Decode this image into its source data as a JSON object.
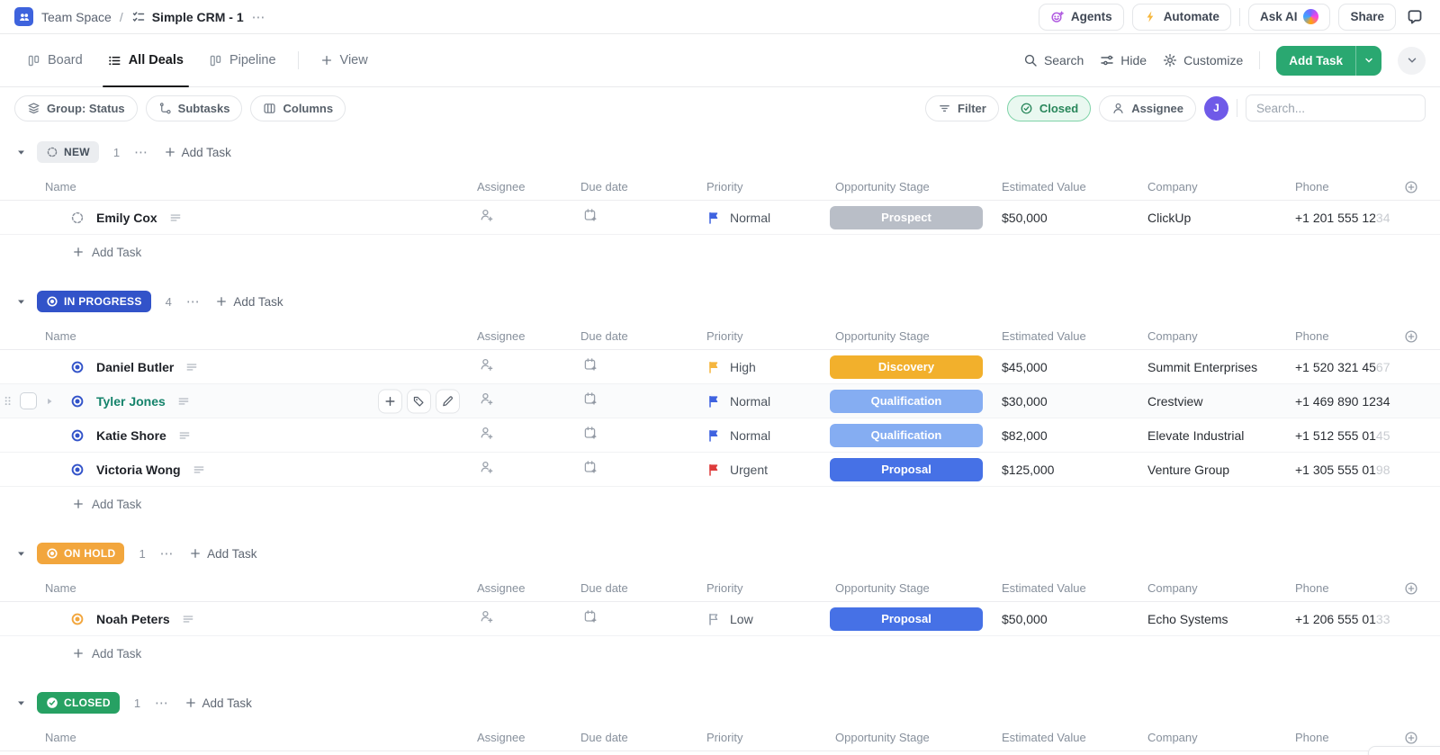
{
  "topbar": {
    "breadcrumb": {
      "space": "Team Space",
      "separator": "/",
      "view": "Simple CRM - 1",
      "more": "⋯"
    },
    "actions": {
      "agents": "Agents",
      "automate": "Automate",
      "ask_ai": "Ask AI",
      "share": "Share"
    }
  },
  "viewbar": {
    "tabs": [
      {
        "label": "Board",
        "icon": "board-icon",
        "active": false
      },
      {
        "label": "All Deals",
        "icon": "list-icon",
        "active": true
      },
      {
        "label": "Pipeline",
        "icon": "board-icon",
        "active": false
      }
    ],
    "add_view": "View",
    "search": "Search",
    "hide": "Hide",
    "customize": "Customize",
    "add_task": "Add Task"
  },
  "toolbar": {
    "group_by": "Group: Status",
    "subtasks": "Subtasks",
    "columns": "Columns",
    "filter": "Filter",
    "closed": "Closed",
    "assignee": "Assignee",
    "avatar_initial": "J",
    "search_placeholder": "Search..."
  },
  "table": {
    "columns": [
      "Name",
      "Assignee",
      "Due date",
      "Priority",
      "Opportunity Stage",
      "Estimated Value",
      "Company",
      "Phone"
    ],
    "add_task_label": "Add Task",
    "more_label": "⋯",
    "colors": {
      "new_pill_bg": "#ebedf0",
      "new_pill_text": "#454f5b",
      "in_progress": "#3253c9",
      "on_hold": "#f2a63d",
      "closed": "#27a163",
      "flag_normal": "#3f63e0",
      "flag_high": "#f5b63f",
      "flag_urgent": "#dd3b3b",
      "flag_low": "#98a1ad",
      "stage_prospect": "#b9bec7",
      "stage_discovery": "#f2b02c",
      "stage_qualification": "#85adf2",
      "stage_proposal": "#4671e6",
      "hover_name": "#15836b"
    },
    "groups": [
      {
        "id": "new",
        "label": "NEW",
        "count": "1",
        "pill_style": "gray",
        "status_icon": "dashed-circle",
        "show_footer": true,
        "rows": [
          {
            "name": "Emily Cox",
            "priority": "Normal",
            "priority_color": "#3f63e0",
            "priority_outline": false,
            "stage": "Prospect",
            "stage_color": "#b9bec7",
            "value": "$50,000",
            "company": "ClickUp",
            "phone": "+1 201 555 1234",
            "phone_fade_chars": 2,
            "hover": false
          }
        ]
      },
      {
        "id": "in-progress",
        "label": "IN PROGRESS",
        "count": "4",
        "pill_style": "blue",
        "status_icon": "ring-dot",
        "show_footer": true,
        "rows": [
          {
            "name": "Daniel Butler",
            "priority": "High",
            "priority_color": "#f5b63f",
            "priority_outline": false,
            "stage": "Discovery",
            "stage_color": "#f2b02c",
            "value": "$45,000",
            "company": "Summit Enterprises",
            "phone": "+1 520 321 4567",
            "phone_fade_chars": 2,
            "hover": false
          },
          {
            "name": "Tyler Jones",
            "priority": "Normal",
            "priority_color": "#3f63e0",
            "priority_outline": false,
            "stage": "Qualification",
            "stage_color": "#85adf2",
            "value": "$30,000",
            "company": "Crestview",
            "phone": "+1 469 890 1234",
            "phone_fade_chars": 0,
            "hover": true
          },
          {
            "name": "Katie Shore",
            "priority": "Normal",
            "priority_color": "#3f63e0",
            "priority_outline": false,
            "stage": "Qualification",
            "stage_color": "#85adf2",
            "value": "$82,000",
            "company": "Elevate Industrial",
            "phone": "+1 512 555 0145",
            "phone_fade_chars": 2,
            "hover": false
          },
          {
            "name": "Victoria Wong",
            "priority": "Urgent",
            "priority_color": "#dd3b3b",
            "priority_outline": false,
            "stage": "Proposal",
            "stage_color": "#4671e6",
            "value": "$125,000",
            "company": "Venture Group",
            "phone": "+1 305 555 0198",
            "phone_fade_chars": 2,
            "hover": false
          }
        ]
      },
      {
        "id": "on-hold",
        "label": "ON HOLD",
        "count": "1",
        "pill_style": "amber",
        "status_icon": "ring-dot",
        "show_footer": true,
        "rows": [
          {
            "name": "Noah Peters",
            "priority": "Low",
            "priority_color": "#98a1ad",
            "priority_outline": true,
            "stage": "Proposal",
            "stage_color": "#4671e6",
            "value": "$50,000",
            "company": "Echo Systems",
            "phone": "+1 206 555 0133",
            "phone_fade_chars": 2,
            "hover": false
          }
        ]
      },
      {
        "id": "closed",
        "label": "CLOSED",
        "count": "1",
        "pill_style": "green",
        "status_icon": "check-circle",
        "show_footer": false,
        "rows": []
      }
    ]
  }
}
